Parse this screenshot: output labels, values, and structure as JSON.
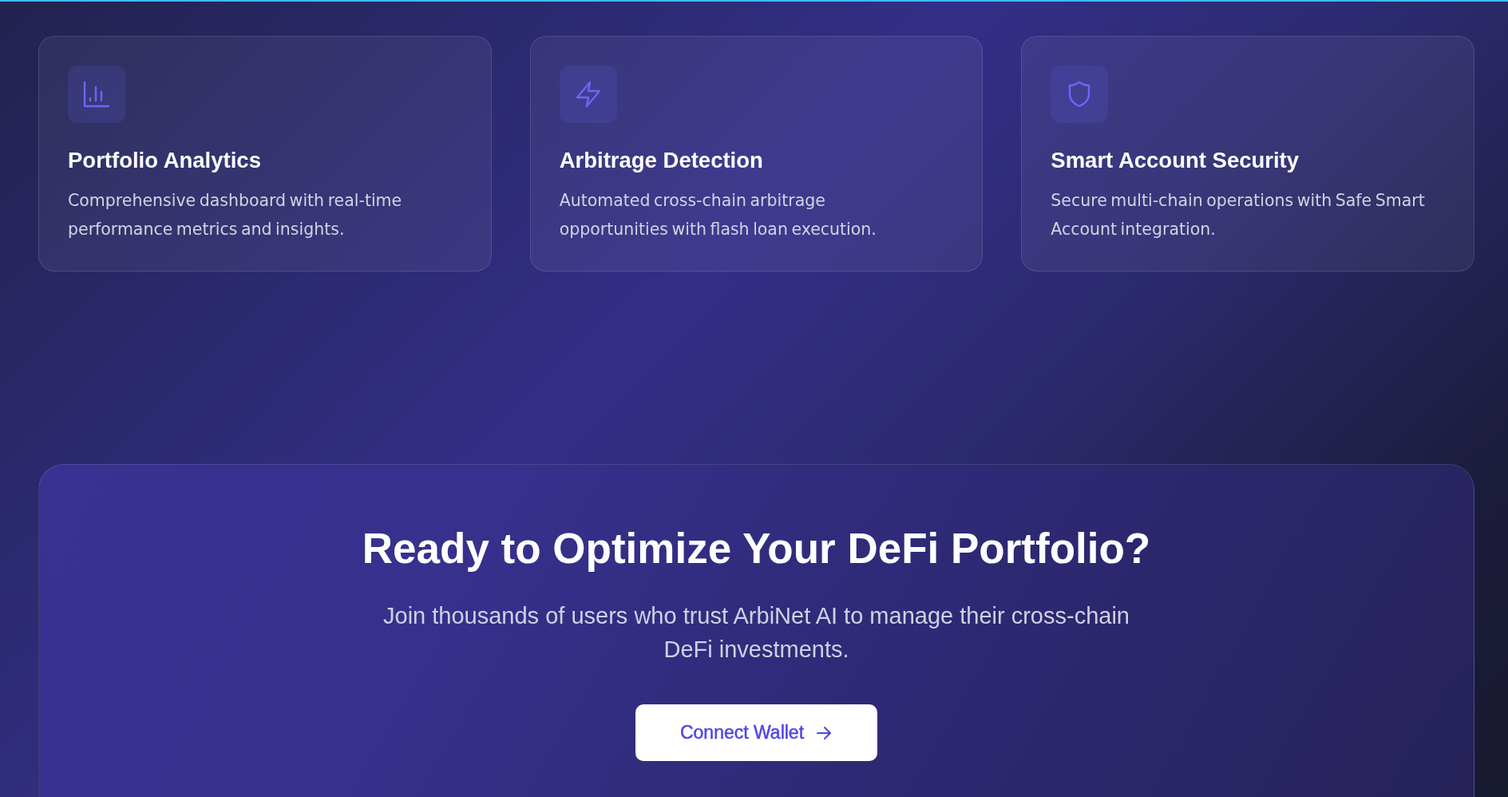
{
  "features": [
    {
      "kind": "chart",
      "title": "Portfolio Analytics",
      "description": "Comprehensive dashboard with real-time performance metrics and insights."
    },
    {
      "kind": "bolt",
      "title": "Arbitrage Detection",
      "description": "Automated cross-chain arbitrage opportunities with flash loan execution."
    },
    {
      "kind": "shield",
      "title": "Smart Account Security",
      "description": "Secure multi-chain operations with Safe Smart Account integration."
    }
  ],
  "cta": {
    "heading": "Ready to Optimize Your DeFi Portfolio?",
    "text": "Join thousands of users who trust ArbiNet AI to manage their cross-chain DeFi investments.",
    "button": {
      "label": "Connect Wallet"
    }
  }
}
